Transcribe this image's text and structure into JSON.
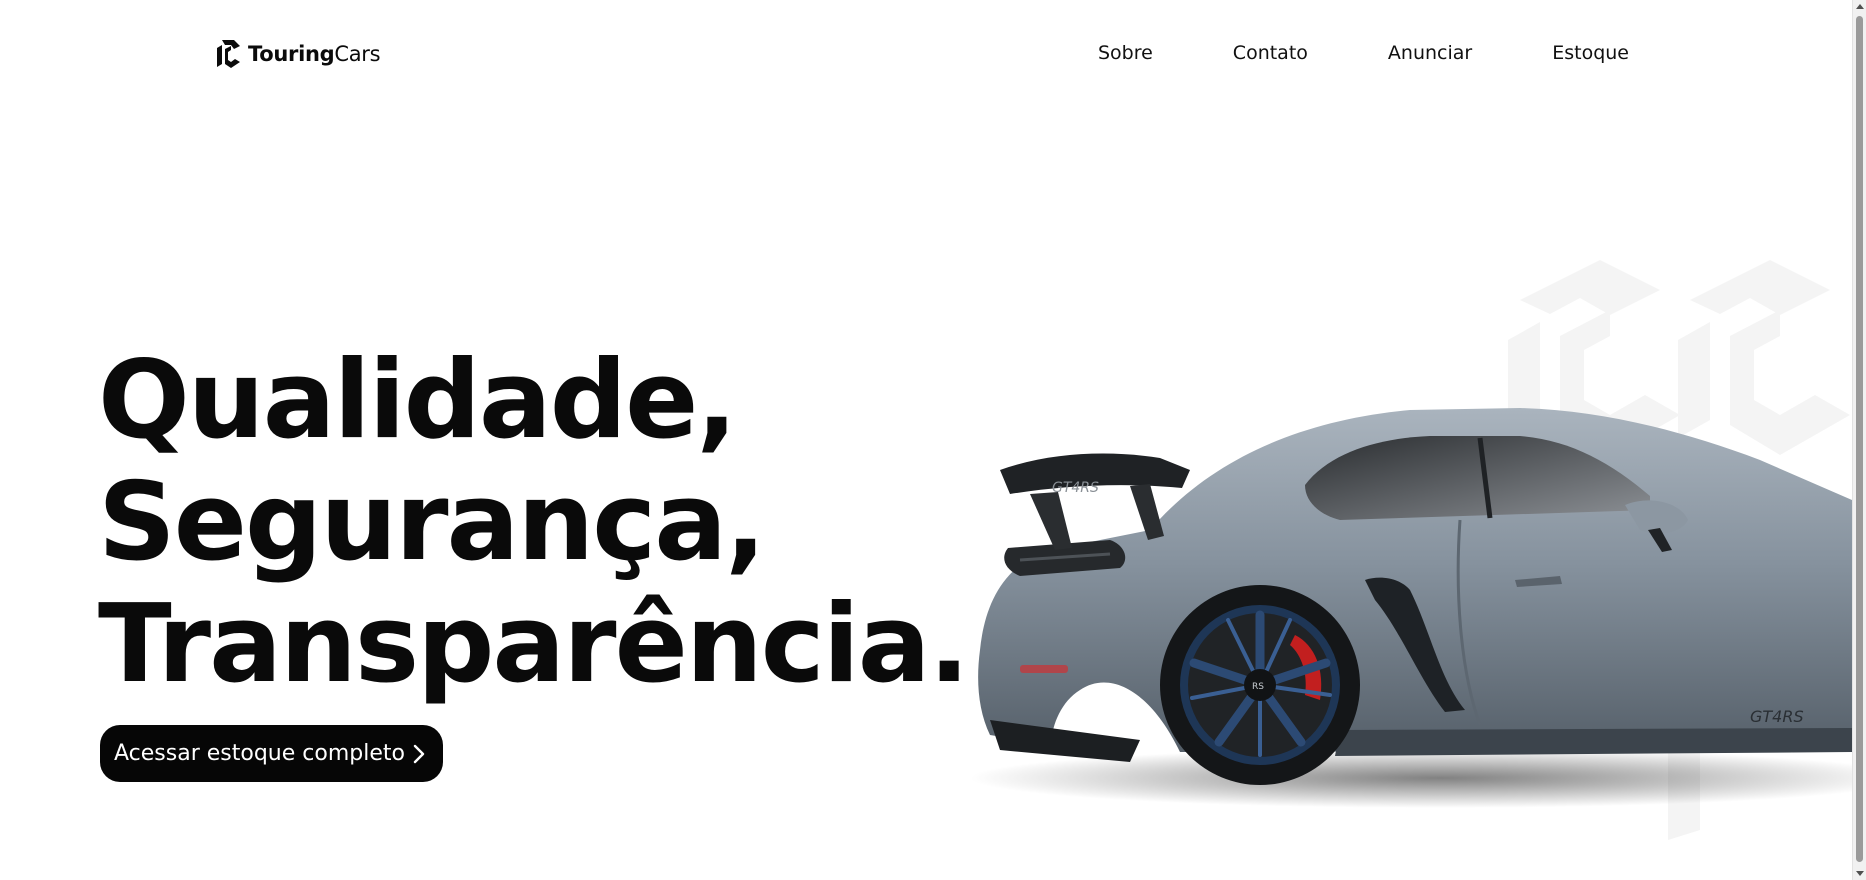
{
  "header": {
    "logo": {
      "bold": "Touring",
      "light": "Cars",
      "icon": "touringcars-logo-icon"
    },
    "nav": [
      {
        "label": "Sobre"
      },
      {
        "label": "Contato"
      },
      {
        "label": "Anunciar"
      },
      {
        "label": "Estoque"
      }
    ]
  },
  "hero": {
    "lines": [
      "Qualidade,",
      "Segurança,",
      "Transparência."
    ],
    "cta": {
      "label": "Acessar estoque completo",
      "icon": "chevron-right-icon"
    }
  },
  "car": {
    "rear_wing_badge": "GT4RS",
    "side_badge": "GT4RS",
    "wheel_badge": "RS",
    "body_color": "#7f8b97",
    "wheel_color": "#2c4a74",
    "caliper_color": "#c21f1f"
  },
  "colors": {
    "background": "#ffffff",
    "text": "#0b0b0b",
    "button_bg": "#060606",
    "button_text": "#ffffff"
  }
}
